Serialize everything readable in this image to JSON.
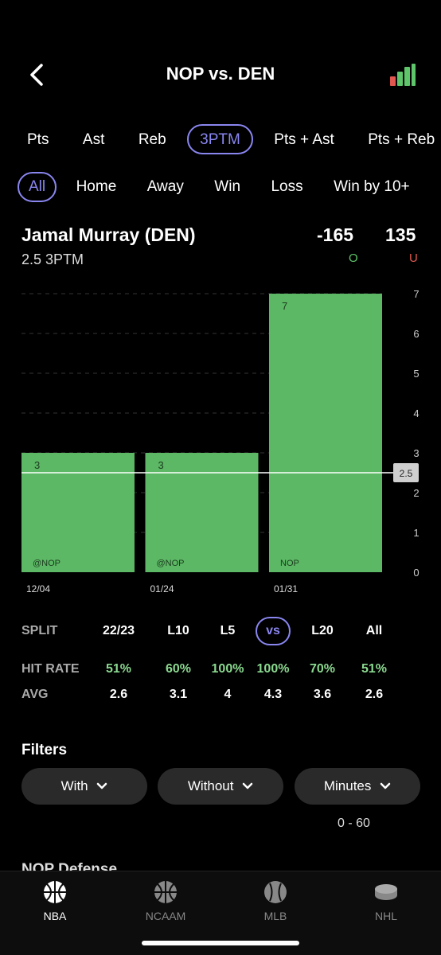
{
  "header": {
    "title": "NOP vs. DEN"
  },
  "stat_tabs": [
    "Pts",
    "Ast",
    "Reb",
    "3PTM",
    "Pts + Ast",
    "Pts + Reb"
  ],
  "stat_tab_active": "3PTM",
  "filter_chips": [
    "All",
    "Home",
    "Away",
    "Win",
    "Loss",
    "Win by 10+"
  ],
  "filter_active": "All",
  "player": {
    "name": "Jamal Murray (DEN)",
    "prop": "2.5 3PTM",
    "over_odds": "-165",
    "under_odds": "135",
    "over_label": "O",
    "under_label": "U"
  },
  "colors": {
    "accent": "#8a86f0",
    "bar": "#5cb865",
    "over": "#5fc56a",
    "under": "#e0584f"
  },
  "chart_data": {
    "type": "bar",
    "categories": [
      "12/04",
      "01/24",
      "01/31"
    ],
    "opponents": [
      "@NOP",
      "@NOP",
      "NOP"
    ],
    "values": [
      3,
      3,
      7
    ],
    "ylim": [
      0,
      7
    ],
    "yticks": [
      "0",
      "1",
      "2",
      "3",
      "4",
      "5",
      "6",
      "7"
    ],
    "line": 2.5,
    "line_label": "2.5",
    "grid": true
  },
  "splits": {
    "label_split": "SPLIT",
    "label_hit": "HIT RATE",
    "label_avg": "AVG",
    "columns": [
      "22/23",
      "L10",
      "L5",
      "vs",
      "L20",
      "All"
    ],
    "hit_rates": [
      "51%",
      "60%",
      "100%",
      "100%",
      "70%",
      "51%"
    ],
    "avgs": [
      "2.6",
      "3.1",
      "4",
      "4.3",
      "3.6",
      "2.6"
    ],
    "active": "vs"
  },
  "filters": {
    "title": "Filters",
    "with_label": "With",
    "without_label": "Without",
    "minutes_label": "Minutes",
    "minutes_range": "0 - 60"
  },
  "peek_section": "NOP Defense",
  "nav": [
    {
      "label": "NBA",
      "icon": "basketball-icon",
      "active": true
    },
    {
      "label": "NCAAM",
      "icon": "basketball-icon",
      "active": false
    },
    {
      "label": "MLB",
      "icon": "baseball-icon",
      "active": false
    },
    {
      "label": "NHL",
      "icon": "hockey-puck-icon",
      "active": false
    }
  ]
}
